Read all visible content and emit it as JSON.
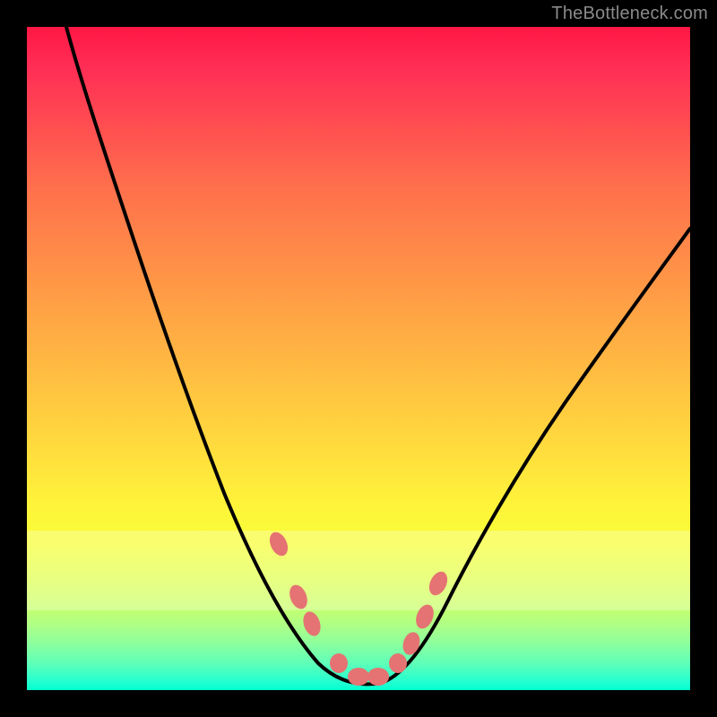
{
  "watermark": "TheBottleneck.com",
  "chart_data": {
    "type": "line",
    "title": "",
    "xlabel": "",
    "ylabel": "",
    "xlim": [
      0,
      100
    ],
    "ylim": [
      0,
      100
    ],
    "grid": false,
    "legend": false,
    "series": [
      {
        "name": "bottleneck-curve",
        "x": [
          6,
          10,
          15,
          20,
          25,
          30,
          35,
          38,
          41,
          44,
          47,
          50,
          53,
          56,
          59,
          62,
          66,
          72,
          80,
          90,
          100
        ],
        "values": [
          100,
          90,
          78,
          66,
          54,
          42,
          30,
          22,
          14,
          8,
          4,
          2,
          2,
          4,
          8,
          14,
          22,
          34,
          48,
          62,
          74
        ]
      }
    ],
    "beads": [
      {
        "x": 38,
        "y": 22
      },
      {
        "x": 41,
        "y": 14
      },
      {
        "x": 43,
        "y": 10
      },
      {
        "x": 47,
        "y": 4
      },
      {
        "x": 50,
        "y": 2
      },
      {
        "x": 53,
        "y": 2
      },
      {
        "x": 56,
        "y": 4
      },
      {
        "x": 58,
        "y": 7
      },
      {
        "x": 60,
        "y": 11
      },
      {
        "x": 62,
        "y": 16
      }
    ],
    "pale_band": {
      "y_start": 24,
      "y_end": 12
    },
    "gradient_stops": [
      {
        "pos": 0,
        "color": "#ff1744"
      },
      {
        "pos": 50,
        "color": "#ffb143"
      },
      {
        "pos": 80,
        "color": "#f6ff37"
      },
      {
        "pos": 100,
        "color": "#00ffcc"
      }
    ]
  }
}
